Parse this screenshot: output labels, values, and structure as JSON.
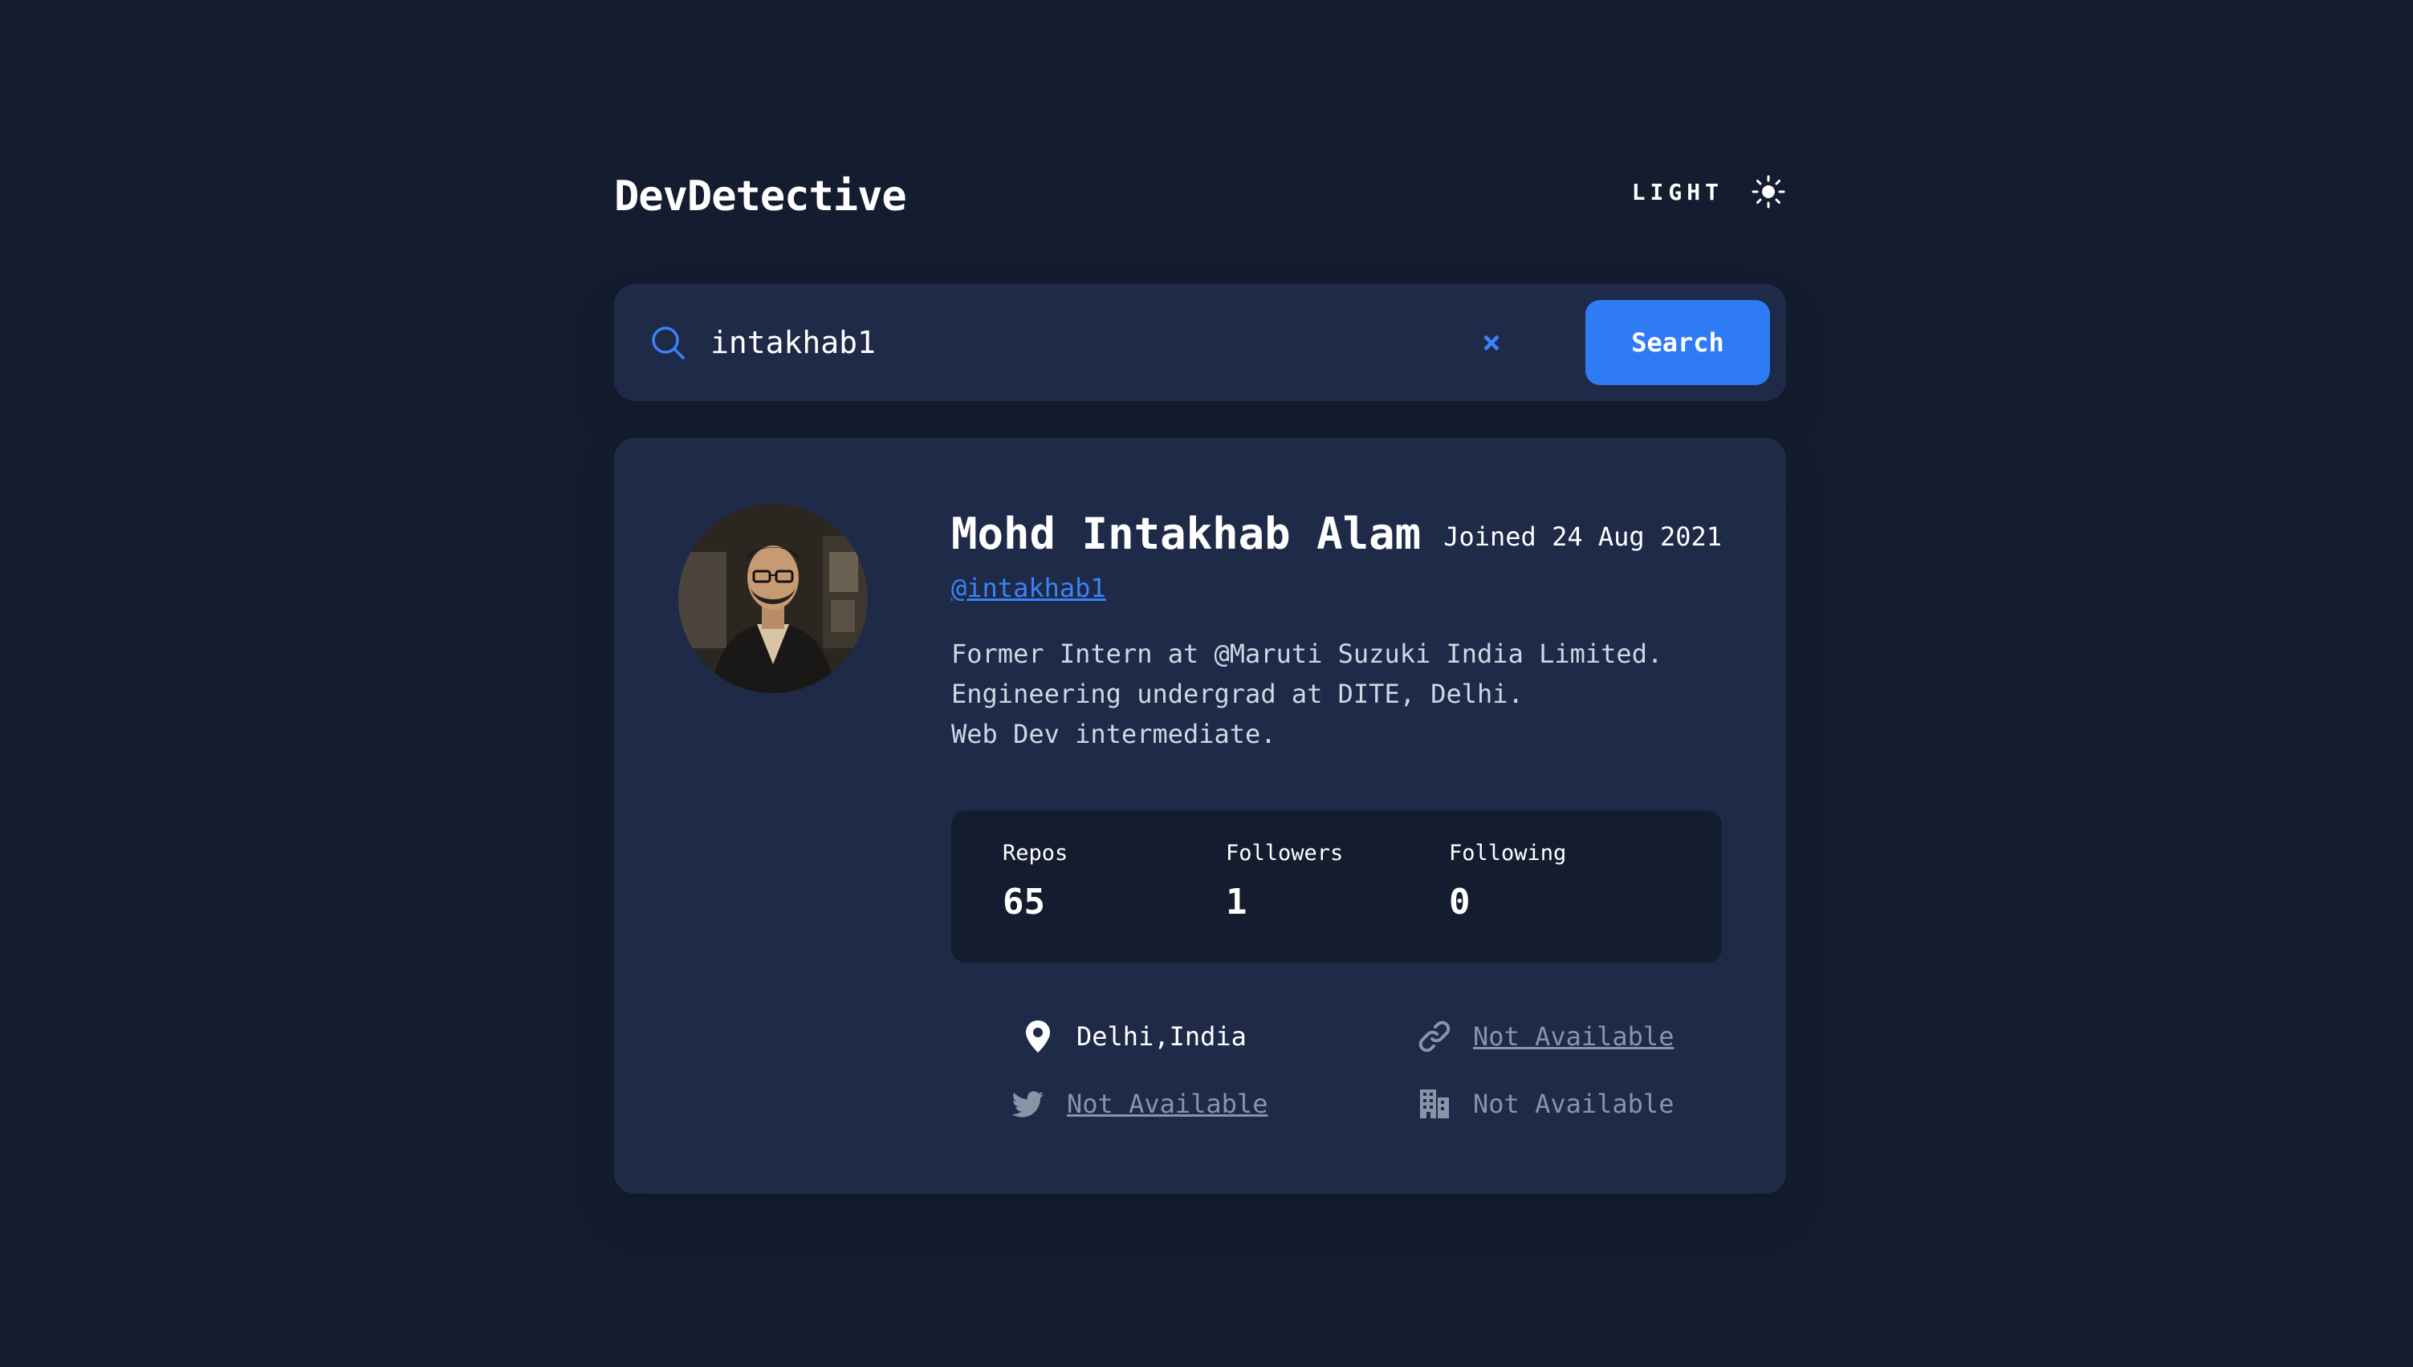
{
  "app": {
    "title": "DevDetective",
    "theme_label": "LIGHT"
  },
  "search": {
    "value": "intakhab1",
    "button_label": "Search"
  },
  "profile": {
    "name": "Mohd Intakhab Alam",
    "joined": "Joined 24 Aug 2021",
    "login": "@intakhab1",
    "bio": [
      "Former Intern at @Maruti Suzuki India Limited.",
      "Engineering undergrad at DITE, Delhi.",
      "Web Dev intermediate."
    ],
    "stats": [
      {
        "label": "Repos",
        "value": "65"
      },
      {
        "label": "Followers",
        "value": "1"
      },
      {
        "label": "Following",
        "value": "0"
      }
    ],
    "info": {
      "location": "Delhi,India",
      "website": "Not Available",
      "twitter": "Not Available",
      "company": "Not Available"
    }
  },
  "colors": {
    "background": "#141d2f",
    "card": "#1e2a47",
    "accent": "#2f7bf4",
    "muted": "#8a93a8"
  },
  "icons": {
    "theme": "sun-icon",
    "search": "search-icon",
    "clear": "close-icon",
    "location": "location-pin-icon",
    "website": "link-icon",
    "twitter": "twitter-icon",
    "company": "building-icon"
  }
}
